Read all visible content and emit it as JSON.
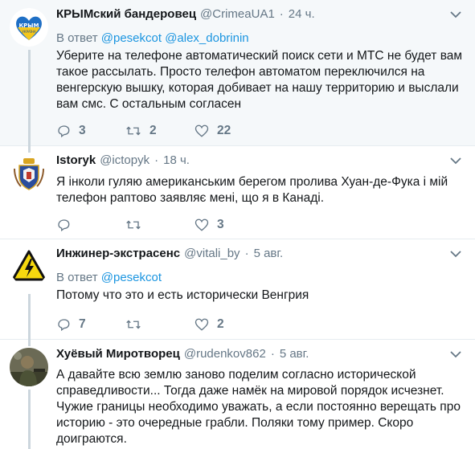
{
  "tweets": [
    {
      "name": "КРЫМский бандеровец",
      "handle": "@CrimeaUA1",
      "time": "24 ч.",
      "reply_prefix": "В ответ",
      "mentions": [
        "@pesekcot",
        "@alex_dobrinin"
      ],
      "text": "Уберите на телефоне автоматический поиск сети и МТС не будет вам такое рассылать. Просто телефон автоматом переключился на венгерскую вышку, которая добивает на нашу территорию и выслали вам смс. С остальным согласен",
      "replies": "3",
      "retweets": "2",
      "likes": "22",
      "avatar_icon": "crimea-ukraine-heart-logo"
    },
    {
      "name": "Istoryk",
      "handle": "@ictopyk",
      "time": "18 ч.",
      "text": "Я інколи гуляю американським берегом пролива Хуан-де-Фука і мій телефон раптово заявляє мені, що я в Канаді.",
      "replies": "",
      "retweets": "",
      "likes": "3",
      "avatar_icon": "coat-of-arms"
    },
    {
      "name": "Инжинер-экстрасенс",
      "handle": "@vitali_by",
      "time": "5 авг.",
      "reply_prefix": "В ответ",
      "mentions": [
        "@pesekcot"
      ],
      "text": "Потому что это и есть исторически Венгрия",
      "replies": "7",
      "retweets": "",
      "likes": "2",
      "avatar_icon": "high-voltage-sign"
    },
    {
      "name": "Хуёвый Миротворец",
      "handle": "@rudenkov862",
      "time": "5 авг.",
      "text": "А давайте всю землю заново поделим согласно исторической справедливости... Тогда даже намёк на мировой порядок исчезнет. Чужие границы необходимо уважать, а если постоянно верещать про историю - это очередные грабли. Поляки тому пример. Скоро доиграются.",
      "avatar_icon": "soldier-photo"
    }
  ],
  "colors": {
    "text": "#14171a",
    "secondary": "#657786",
    "link": "#1b95e0",
    "border": "#e6ecf0",
    "thread_line": "#ccd6dd",
    "highlight_bg": "#f5f8fa"
  }
}
